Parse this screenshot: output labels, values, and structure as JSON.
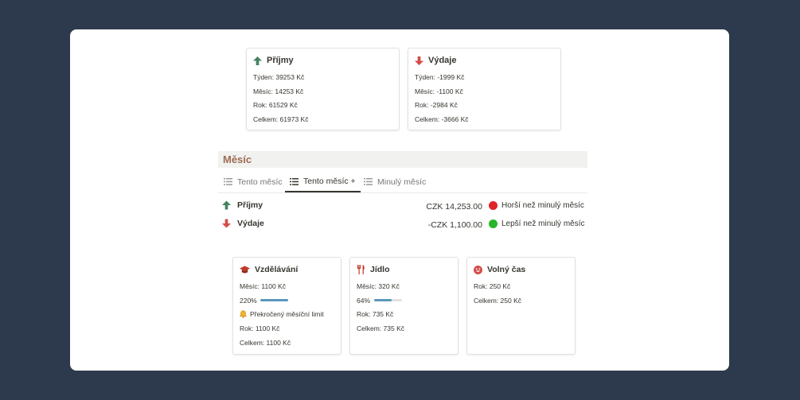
{
  "income_card": {
    "title": "Příjmy",
    "week": "Týden: 39253 Kč",
    "month": "Měsíc: 14253 Kč",
    "year": "Rok: 61529 Kč",
    "total": "Celkem: 61973 Kč"
  },
  "expense_card": {
    "title": "Výdaje",
    "week": "Týden: -1999 Kč",
    "month": "Měsíc: -1100 Kč",
    "year": "Rok: -2984 Kč",
    "total": "Celkem: -3666 Kč"
  },
  "section": {
    "title": "Měsíc",
    "tabs": [
      {
        "label": "Tento měsíc",
        "active": false
      },
      {
        "label": "Tento měsíc +",
        "active": true
      },
      {
        "label": "Minulý měsíc",
        "active": false
      }
    ]
  },
  "rows": [
    {
      "label": "Příjmy",
      "amount": "CZK 14,253.00",
      "status": "Horší než minulý měsíc",
      "status_color": "#e0242a"
    },
    {
      "label": "Výdaje",
      "amount": "-CZK 1,100.00",
      "status": "Lepší než minulý měsíc",
      "status_color": "#27b52c"
    }
  ],
  "categories": [
    {
      "title": "Vzdělávání",
      "icon": "graduation-cap-icon",
      "month": "Měsíc: 1100 Kč",
      "percent_label": "220%",
      "progress": 2.2,
      "warning": "Překročený měsíční limit",
      "year": "Rok: 1100 Kč",
      "total": "Celkem: 1100 Kč"
    },
    {
      "title": "Jídlo",
      "icon": "fork-knife-icon",
      "month": "Měsíc: 320 Kč",
      "percent_label": "64%",
      "progress": 0.64,
      "year": "Rok: 735 Kč",
      "total": "Celkem: 735 Kč"
    },
    {
      "title": "Volný čas",
      "icon": "smiley-icon",
      "year": "Rok: 250 Kč",
      "total": "Celkem: 250 Kč"
    }
  ],
  "colors": {
    "background": "#2d3a4d",
    "income_arrow": "#448361",
    "expense_arrow": "#d44c47",
    "progress_fill": "#5b97bd",
    "section_title": "#9f6b53"
  }
}
